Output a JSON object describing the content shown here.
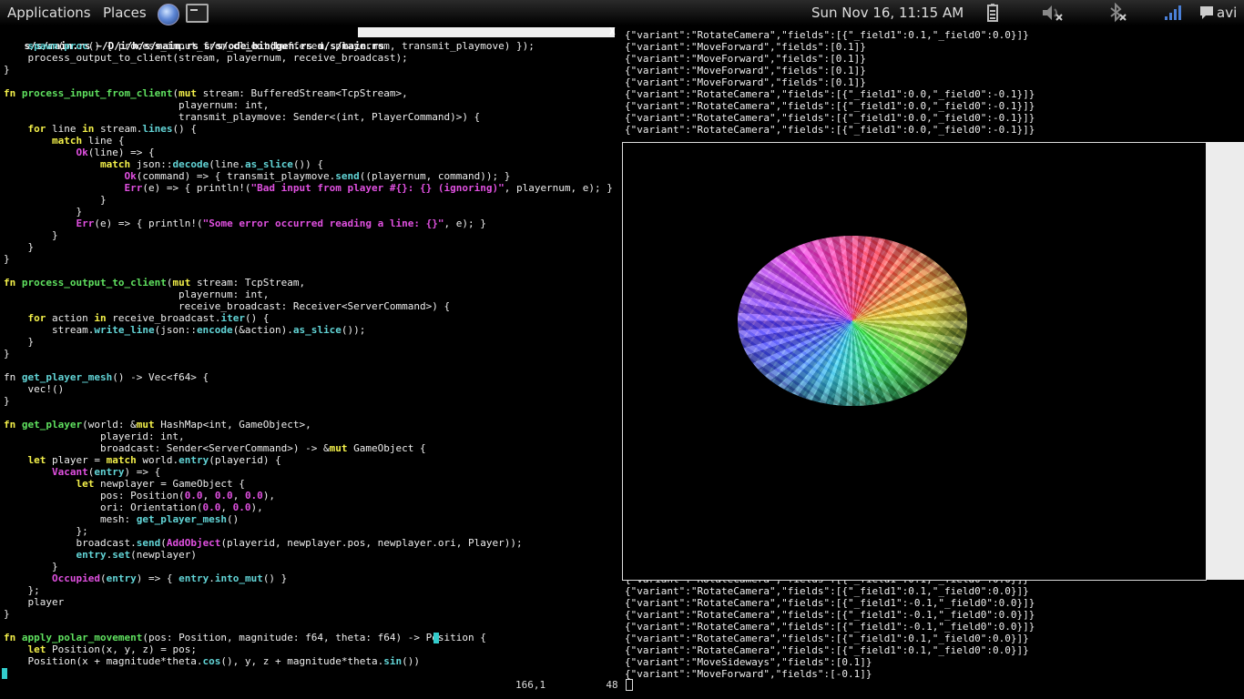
{
  "panel": {
    "applications": "Applications",
    "places": "Places",
    "clock": "Sun Nov 16, 11:15 AM",
    "user": "avi"
  },
  "vim": {
    "tabs": [
      "s/s/main.rs",
      "~/D/i/h/s/main.rs",
      "s/s/ode_bindgen.rs",
      "m/s/main.rs"
    ],
    "tab_close": "X",
    "ruler_pos": "166,1",
    "ruler_pct": "48%"
  },
  "log": {
    "top_lines": [
      "{\"variant\":\"RotateCamera\",\"fields\":[{\"_field1\":0.1,\"_field0\":0.0}]}",
      "{\"variant\":\"MoveForward\",\"fields\":[0.1]}",
      "{\"variant\":\"MoveForward\",\"fields\":[0.1]}",
      "{\"variant\":\"MoveForward\",\"fields\":[0.1]}",
      "{\"variant\":\"MoveForward\",\"fields\":[0.1]}",
      "{\"variant\":\"RotateCamera\",\"fields\":[{\"_field1\":0.0,\"_field0\":-0.1}]}",
      "{\"variant\":\"RotateCamera\",\"fields\":[{\"_field1\":0.0,\"_field0\":-0.1}]}",
      "{\"variant\":\"RotateCamera\",\"fields\":[{\"_field1\":0.0,\"_field0\":-0.1}]}",
      "{\"variant\":\"RotateCamera\",\"fields\":[{\"_field1\":0.0,\"_field0\":-0.1}]}"
    ],
    "bottom_lines": [
      "{\"variant\":\"RotateCamera\",\"fields\":[{\"_field1\":0.1,\"_field0\":0.0}]}",
      "{\"variant\":\"RotateCamera\",\"fields\":[{\"_field1\":0.1,\"_field0\":0.0}]}",
      "{\"variant\":\"RotateCamera\",\"fields\":[{\"_field1\":-0.1,\"_field0\":0.0}]}",
      "{\"variant\":\"RotateCamera\",\"fields\":[{\"_field1\":-0.1,\"_field0\":0.0}]}",
      "{\"variant\":\"RotateCamera\",\"fields\":[{\"_field1\":-0.1,\"_field0\":0.0}]}",
      "{\"variant\":\"RotateCamera\",\"fields\":[{\"_field1\":0.1,\"_field0\":0.0}]}",
      "{\"variant\":\"RotateCamera\",\"fields\":[{\"_field1\":0.1,\"_field0\":0.0}]}",
      "{\"variant\":\"MoveSideways\",\"fields\":[0.1]}",
      "{\"variant\":\"MoveForward\",\"fields\":[-0.1]}"
    ]
  },
  "code_lines": [
    "    spawn(proc() { process_input_from_client(buffered, playernum, transmit_playmove) });",
    "    process_output_to_client(stream, playernum, receive_broadcast);",
    "}",
    "",
    "fn process_input_from_client(mut stream: BufferedStream<TcpStream>,",
    "                             playernum: int,",
    "                             transmit_playmove: Sender<(int, PlayerCommand)>) {",
    "    for line in stream.lines() {",
    "        match line {",
    "            Ok(line) => {",
    "                match json::decode(line.as_slice()) {",
    "                    Ok(command) => { transmit_playmove.send((playernum, command)); }",
    "                    Err(e) => { println!(\"Bad input from player #{}: {} (ignoring)\", playernum, e); }",
    "                }",
    "            }",
    "            Err(e) => { println!(\"Some error occurred reading a line: {}\", e); }",
    "        }",
    "    }",
    "}",
    "",
    "fn process_output_to_client(mut stream: TcpStream,",
    "                             playernum: int,",
    "                             receive_broadcast: Receiver<ServerCommand>) {",
    "    for action in receive_broadcast.iter() {",
    "        stream.write_line(json::encode(&action).as_slice());",
    "    }",
    "}",
    "",
    "fn get_player_mesh() -> Vec<f64> {",
    "    vec!()",
    "}",
    "",
    "fn get_player(world: &mut HashMap<int, GameObject>,",
    "                playerid: int,",
    "                broadcast: Sender<ServerCommand>) -> &mut GameObject {",
    "    let player = match world.entry(playerid) {",
    "        Vacant(entry) => {",
    "            let newplayer = GameObject {",
    "                pos: Position(0.0, 0.0, 0.0),",
    "                ori: Orientation(0.0, 0.0),",
    "                mesh: get_player_mesh()",
    "            };",
    "            broadcast.send(AddObject(playerid, newplayer.pos, newplayer.ori, Player));",
    "            entry.set(newplayer)",
    "        }",
    "        Occupied(entry) => { entry.into_mut() }",
    "    };",
    "    player",
    "}",
    "",
    "fn apply_polar_movement(pos: Position, magnitude: f64, theta: f64) -> Position {",
    "    let Position(x, y, z) = pos;",
    "    Position(x + magnitude*theta.cos(), y, z + magnitude*theta.sin())",
    ""
  ]
}
